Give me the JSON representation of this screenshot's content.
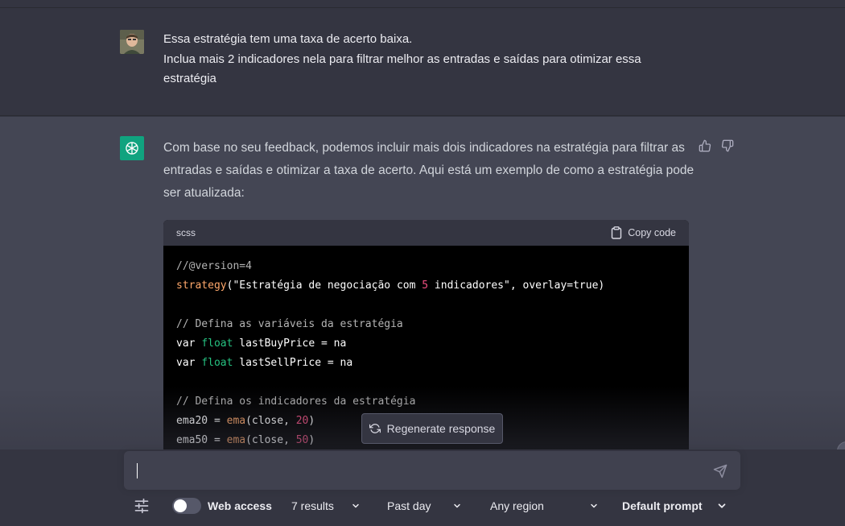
{
  "user_message": {
    "lines": [
      "Essa estratégia tem uma taxa de acerto baixa.",
      "Inclua mais 2 indicadores nela para filtrar melhor as entradas e saídas para otimizar essa estratégia"
    ]
  },
  "assistant_message": {
    "text": "Com base no seu feedback, podemos incluir mais dois indicadores na estratégia para filtrar as entradas e saídas e otimizar a taxa de acerto. Aqui está um exemplo de como a estratégia pode ser atualizada:",
    "code_block": {
      "language": "scss",
      "copy_label": "Copy code",
      "lines": [
        "//@version=4",
        "strategy(\"Estratégia de negociação com 5 indicadores\", overlay=true)",
        "",
        "// Defina as variáveis da estratégia",
        "var float lastBuyPrice = na",
        "var float lastSellPrice = na",
        "",
        "// Defina os indicadores da estratégia",
        "ema20 = ema(close, 20)",
        "ema50 = ema(close, 50)"
      ]
    }
  },
  "regenerate_label": "Regenerate response",
  "input": {
    "placeholder": "",
    "value": ""
  },
  "toolbar": {
    "web_access_label": "Web access",
    "results_label": "7 results",
    "time_label": "Past day",
    "region_label": "Any region",
    "prompt_label": "Default prompt"
  },
  "colors": {
    "background": "#343541",
    "assistant_background": "#444654",
    "input_background": "#40414f",
    "accent": "#10a37f"
  }
}
